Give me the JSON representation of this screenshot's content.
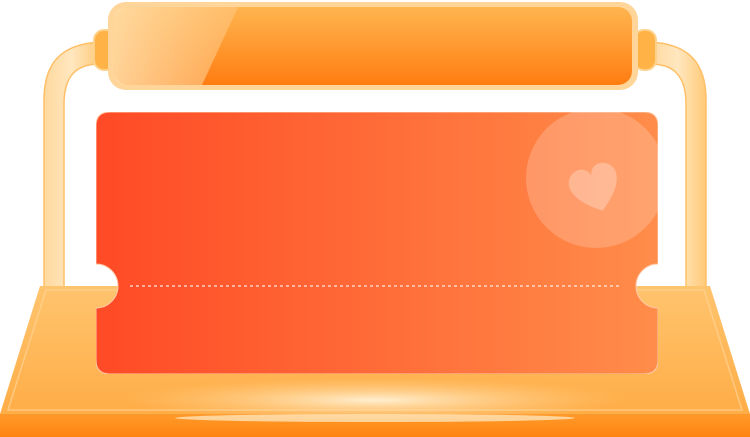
{
  "banner": {
    "title": ""
  },
  "ticket": {
    "icon": "heart-icon"
  },
  "colors": {
    "stand_light": "#ffcf8c",
    "stand_mid": "#ffb347",
    "stand_dark": "#ff8a1a",
    "banner_light": "#ffc06a",
    "banner_dark": "#ff7a12",
    "ticket_start": "#ff4a26",
    "ticket_end": "#ff8d4a",
    "dash": "#ffffff"
  }
}
